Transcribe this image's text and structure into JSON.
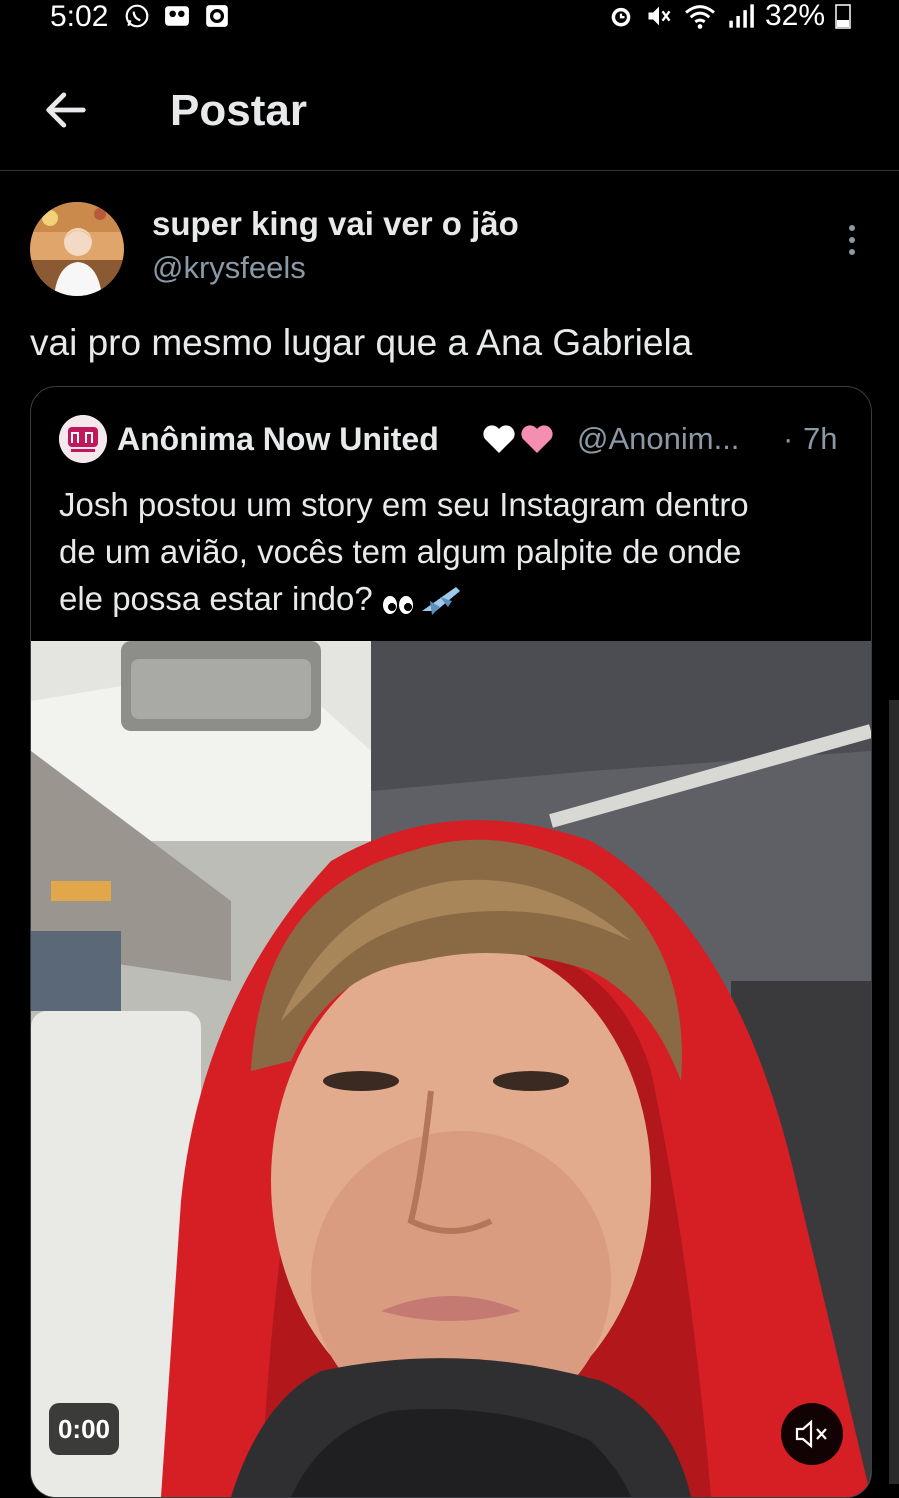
{
  "status_bar": {
    "time": "5:02",
    "battery": "32%",
    "icons": [
      "whatsapp-icon",
      "voicemail-icon",
      "app-icon",
      "alarm-icon",
      "mute-icon",
      "wifi-icon",
      "signal-icon",
      "battery-icon"
    ]
  },
  "header": {
    "title": "Postar",
    "back_icon": "arrow-left-icon"
  },
  "tweet": {
    "name": "super king vai ver o jão",
    "handle": "@krysfeels",
    "text": "vai pro mesmo lugar que a Ana Gabriela"
  },
  "quote": {
    "name": "Anônima Now United",
    "hearts": "white-heart pink-heart",
    "handle": "@Anonim...",
    "dot": "·",
    "time": "7h",
    "text_lines": [
      "Josh postou um story em seu Instagram dentro",
      "de um avião, vocês tem algum palpite de onde",
      "ele possa estar indo?"
    ],
    "trailing_emoji": "eyes airplane",
    "video": {
      "timestamp": "0:00",
      "muted": true
    }
  },
  "colors": {
    "background": "#000000",
    "text": "#e7e9ea",
    "muted_text": "#8b98a5",
    "border": "#2f3336",
    "hoodie": "#d61f24"
  }
}
